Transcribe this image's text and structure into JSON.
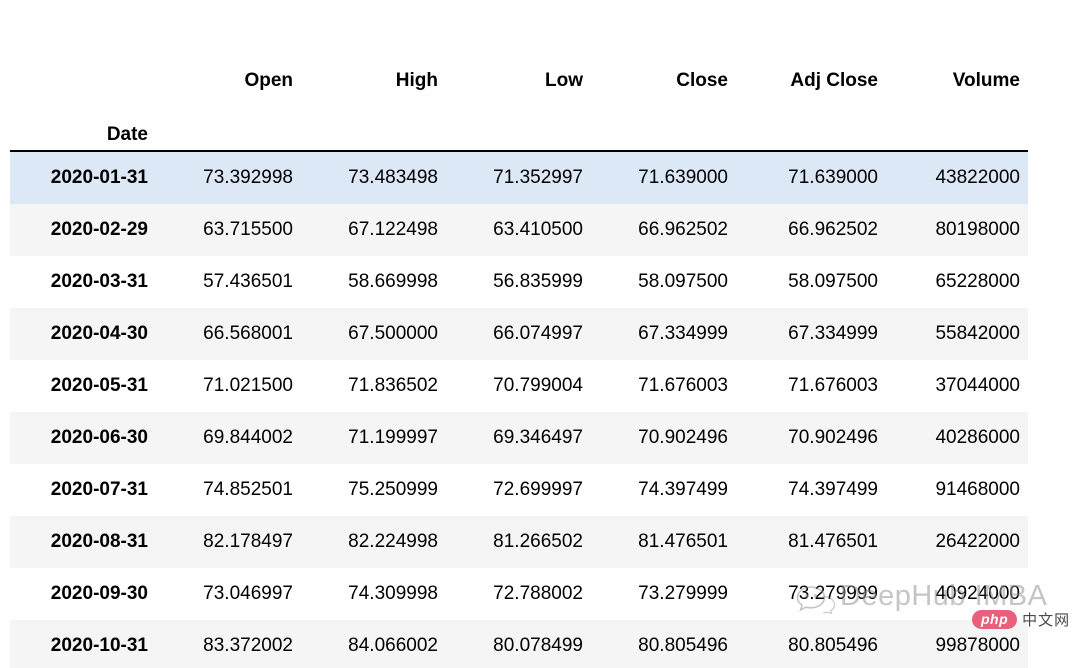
{
  "table": {
    "index_name": "Date",
    "columns": [
      "Open",
      "High",
      "Low",
      "Close",
      "Adj Close",
      "Volume"
    ],
    "rows": [
      {
        "date": "2020-01-31",
        "open": "73.392998",
        "high": "73.483498",
        "low": "71.352997",
        "close": "71.639000",
        "adj_close": "71.639000",
        "volume": "43822000",
        "highlighted": true
      },
      {
        "date": "2020-02-29",
        "open": "63.715500",
        "high": "67.122498",
        "low": "63.410500",
        "close": "66.962502",
        "adj_close": "66.962502",
        "volume": "80198000",
        "highlighted": false
      },
      {
        "date": "2020-03-31",
        "open": "57.436501",
        "high": "58.669998",
        "low": "56.835999",
        "close": "58.097500",
        "adj_close": "58.097500",
        "volume": "65228000",
        "highlighted": false
      },
      {
        "date": "2020-04-30",
        "open": "66.568001",
        "high": "67.500000",
        "low": "66.074997",
        "close": "67.334999",
        "adj_close": "67.334999",
        "volume": "55842000",
        "highlighted": false
      },
      {
        "date": "2020-05-31",
        "open": "71.021500",
        "high": "71.836502",
        "low": "70.799004",
        "close": "71.676003",
        "adj_close": "71.676003",
        "volume": "37044000",
        "highlighted": false
      },
      {
        "date": "2020-06-30",
        "open": "69.844002",
        "high": "71.199997",
        "low": "69.346497",
        "close": "70.902496",
        "adj_close": "70.902496",
        "volume": "40286000",
        "highlighted": false
      },
      {
        "date": "2020-07-31",
        "open": "74.852501",
        "high": "75.250999",
        "low": "72.699997",
        "close": "74.397499",
        "adj_close": "74.397499",
        "volume": "91468000",
        "highlighted": false
      },
      {
        "date": "2020-08-31",
        "open": "82.178497",
        "high": "82.224998",
        "low": "81.266502",
        "close": "81.476501",
        "adj_close": "81.476501",
        "volume": "26422000",
        "highlighted": false
      },
      {
        "date": "2020-09-30",
        "open": "73.046997",
        "high": "74.309998",
        "low": "72.788002",
        "close": "73.279999",
        "adj_close": "73.279999",
        "volume": "40924000",
        "highlighted": false
      },
      {
        "date": "2020-10-31",
        "open": "83.372002",
        "high": "84.066002",
        "low": "80.078499",
        "close": "80.805496",
        "adj_close": "80.805496",
        "volume": "99878000",
        "highlighted": false
      }
    ]
  },
  "watermark": {
    "text": "DeepHub IMBA",
    "icon": "wechat-bubble-icon"
  },
  "badge": {
    "brand": "php",
    "label": "中文网"
  },
  "colors": {
    "highlight_row": "#dde8f7",
    "stripe_row": "#f5f5f5",
    "rule": "#000000",
    "badge_pill": "#e8607c"
  }
}
